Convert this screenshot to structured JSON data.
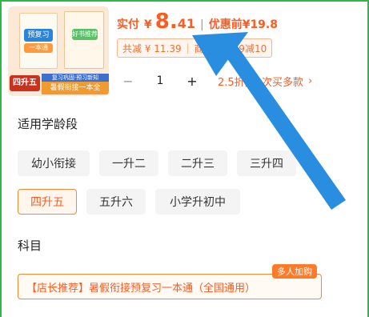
{
  "product": {
    "image_alt": "暑假衔接预复习一本通",
    "grade_tag": "四升五",
    "banner": "暑假衔接一本全",
    "cover_blue": "预复习",
    "cover_tag": "一本通",
    "cover_green": "好书推荐",
    "cover_strip": "复习巩固·预习新知"
  },
  "price": {
    "label": "实付",
    "currency": "¥",
    "integer": "8.",
    "decimal": "41",
    "separator": "|",
    "original_label": "优惠前",
    "original_price": "¥19.8"
  },
  "discount": {
    "total_saved": "共减 ¥ 11.39",
    "divider": "|",
    "coupon": "商品券满19减10"
  },
  "quantity": {
    "minus": "−",
    "value": "1",
    "plus": "+",
    "bulk_text": "2.5折, 一次买多款",
    "chevron": "›"
  },
  "age_section": {
    "title": "适用学龄段",
    "options": [
      {
        "label": "幼小衔接",
        "selected": false
      },
      {
        "label": "一升二",
        "selected": false
      },
      {
        "label": "二升三",
        "selected": false
      },
      {
        "label": "三升四",
        "selected": false
      },
      {
        "label": "四升五",
        "selected": true
      },
      {
        "label": "五升六",
        "selected": false
      },
      {
        "label": "小学升初中",
        "selected": false
      }
    ]
  },
  "subject_section": {
    "title": "科目",
    "option": "【店长推荐】暑假衔接预复习一本通（全国通用）",
    "badge": "多人加购"
  },
  "colors": {
    "accent": "#ff5a1f",
    "arrow": "#2a8ee0",
    "frame": "#2fb84a"
  }
}
